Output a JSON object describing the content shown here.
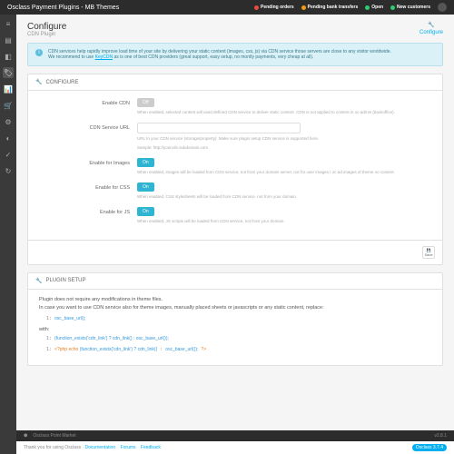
{
  "topbar": {
    "title": "Osclass Payment Plugins - MB Themes",
    "stats": [
      {
        "label": "Pending orders",
        "color": "red"
      },
      {
        "label": "Pending bank transfers",
        "color": "orange"
      },
      {
        "label": "Open",
        "color": "green"
      },
      {
        "label": "New customers",
        "color": "green"
      }
    ]
  },
  "sidebar": {
    "items": [
      "≡",
      "▤",
      "◧",
      "🏷",
      "📊",
      "🛒",
      "⚙",
      "◐",
      "✓",
      "↻"
    ]
  },
  "page": {
    "title": "Configure",
    "subtitle": "CDN Plugin",
    "config": "Configure"
  },
  "info": {
    "line1": "CDN services help rapidly improve load time of your site by delivering your static content (images, css, js) via CDN service those servers are close to any visitor worldwide.",
    "line2a": "We recommend to use ",
    "link": "KeyCDN",
    "line2b": " as is one of best CDN providers (great support, easy setup, no montly payments, very cheap at all)."
  },
  "configure": {
    "head": "CONFIGURE",
    "rows": {
      "enable": {
        "label": "Enable CDN",
        "toggle": "Off",
        "help": "When enabled, selected content will used defined CDN service to deliver static content. CDN is not applied to content in oc-admin (backoffice)."
      },
      "url": {
        "label": "CDN Service URL",
        "help1": "URL to your CDN service (storage/property). Make sure plugin setup CDN service is supported here.",
        "help2": "Sample: http://yourcdn.subdomain.com"
      },
      "images": {
        "label": "Enable for Images",
        "toggle": "On",
        "help": "When enabled, images will be loaded from CDN service, not from your domain server, not for user images / oc-ad images of theme oc-content."
      },
      "css": {
        "label": "Enable for CSS",
        "toggle": "On",
        "help": "When enabled, CSS stylesheets will be loaded from CDN service, not from your domain."
      },
      "js": {
        "label": "Enable for JS",
        "toggle": "On",
        "help": "When enabled, JS scripts will be loaded from CDN service, not from your domain."
      }
    },
    "save": "Save"
  },
  "setup": {
    "head": "PLUGIN SETUP",
    "intro1": "Plugin does not require any modifications in theme files.",
    "intro2": "In case you want to use CDN service also for theme images, manually placed sheets or javascripts or any static content, replace:",
    "code1": "osc_base_url();",
    "with": "with:",
    "code2": "(function_exists('cdn_link') ? cdn_link() : osc_base_url());",
    "code3": "<?php echo (function_exists('cdn_link') ? cdn_link() : osc_base_url()); ?>"
  },
  "bottombar": {
    "left": "Osclass Point Market",
    "version": "v2.8.1"
  },
  "footer": {
    "text": "Thank you for using Osclass · ",
    "links": [
      "Documentation",
      "Forums",
      "Feedback"
    ],
    "version": "Osclass 3.7.4"
  }
}
